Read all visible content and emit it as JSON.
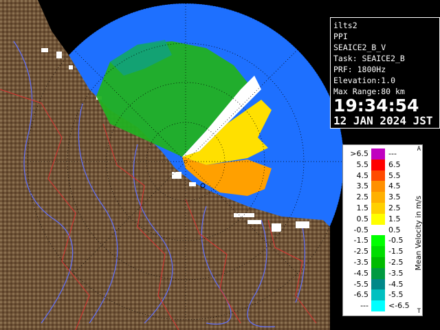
{
  "info": {
    "site": "ilts2",
    "scan_type": "PPI",
    "product": "SEAICE2_B_V",
    "task": "Task: SEAICE2_B",
    "prf": "PRF: 1800Hz",
    "elevation": "Elevation:1.0",
    "max_range": "Max Range:80 km",
    "time": "19:34:54",
    "date": "12 JAN 2024 JST"
  },
  "legend": {
    "title": "Mean Velocity in m/s",
    "top_mark": "A",
    "bottom_mark": "T",
    "rows": [
      {
        "lo": ">6.5",
        "hi": "---",
        "color": "#c000c0"
      },
      {
        "lo": "5.5",
        "hi": "6.5",
        "color": "#ff0000"
      },
      {
        "lo": "4.5",
        "hi": "5.5",
        "color": "#ff4a00"
      },
      {
        "lo": "3.5",
        "hi": "4.5",
        "color": "#ff9000"
      },
      {
        "lo": "2.5",
        "hi": "3.5",
        "color": "#ffb000"
      },
      {
        "lo": "1.5",
        "hi": "2.5",
        "color": "#ffd000"
      },
      {
        "lo": "0.5",
        "hi": "1.5",
        "color": "#ffff00"
      },
      {
        "lo": "-0.5",
        "hi": "0.5",
        "color": "#ffffff"
      },
      {
        "lo": "-1.5",
        "hi": "-0.5",
        "color": "#00ff00"
      },
      {
        "lo": "-2.5",
        "hi": "-1.5",
        "color": "#00dd00"
      },
      {
        "lo": "-3.5",
        "hi": "-2.5",
        "color": "#00bb00"
      },
      {
        "lo": "-4.5",
        "hi": "-3.5",
        "color": "#009a40"
      },
      {
        "lo": "-5.5",
        "hi": "-4.5",
        "color": "#008888"
      },
      {
        "lo": "-6.5",
        "hi": "-5.5",
        "color": "#00c0c0"
      },
      {
        "lo": "---",
        "hi": "<-6.5",
        "color": "#00ffff"
      }
    ]
  },
  "colors": {
    "background": "#000000",
    "range_disk": "#1e60ff",
    "sea_near": "#0050d0",
    "land": "#7a6040",
    "rivers": "#6060ff",
    "boundaries": "#ff3030"
  }
}
